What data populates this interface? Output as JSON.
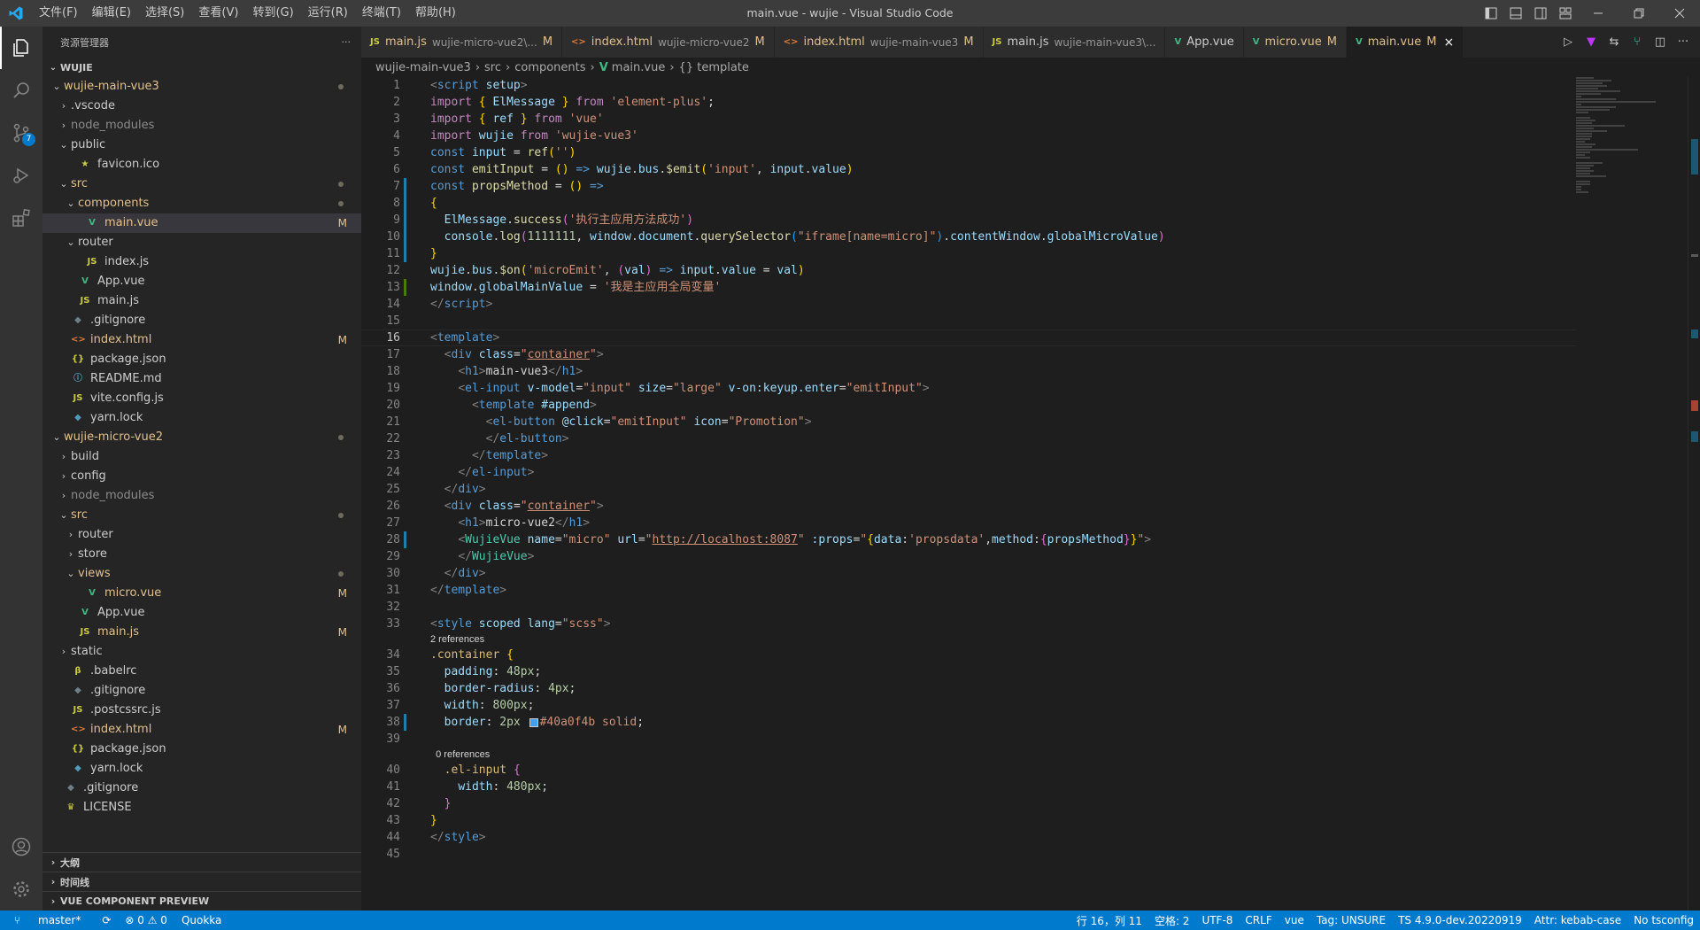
{
  "titlebar": {
    "menu": [
      "文件(F)",
      "编辑(E)",
      "选择(S)",
      "查看(V)",
      "转到(G)",
      "运行(R)",
      "终端(T)",
      "帮助(H)"
    ],
    "title": "main.vue - wujie - Visual Studio Code"
  },
  "activity": {
    "scm_badge": "7"
  },
  "sidebar": {
    "title": "资源管理器",
    "more": "···",
    "workspace": "WUJIE",
    "tree": [
      {
        "label": "wujie-main-vue3",
        "depth": 0,
        "type": "folder-open",
        "cls": "c-mod",
        "dot": true
      },
      {
        "label": ".vscode",
        "depth": 1,
        "type": "folder",
        "cls": "c-norm"
      },
      {
        "label": "node_modules",
        "depth": 1,
        "type": "folder",
        "cls": "c-dim"
      },
      {
        "label": "public",
        "depth": 1,
        "type": "folder-open",
        "cls": "c-norm"
      },
      {
        "label": "favicon.ico",
        "depth": 2,
        "type": "star",
        "cls": "c-norm"
      },
      {
        "label": "src",
        "depth": 1,
        "type": "folder-open",
        "cls": "c-mod",
        "dot": true
      },
      {
        "label": "components",
        "depth": 2,
        "type": "folder-open",
        "cls": "c-mod",
        "dot": true
      },
      {
        "label": "main.vue",
        "depth": 3,
        "type": "vue",
        "cls": "c-mod",
        "status": "M",
        "selected": true
      },
      {
        "label": "router",
        "depth": 2,
        "type": "folder-open",
        "cls": "c-norm"
      },
      {
        "label": "index.js",
        "depth": 3,
        "type": "js",
        "cls": "c-norm"
      },
      {
        "label": "App.vue",
        "depth": 2,
        "type": "vue",
        "cls": "c-norm"
      },
      {
        "label": "main.js",
        "depth": 2,
        "type": "js",
        "cls": "c-norm"
      },
      {
        "label": ".gitignore",
        "depth": 1,
        "type": "git",
        "cls": "c-norm"
      },
      {
        "label": "index.html",
        "depth": 1,
        "type": "html",
        "cls": "c-mod",
        "status": "M"
      },
      {
        "label": "package.json",
        "depth": 1,
        "type": "json",
        "cls": "c-norm"
      },
      {
        "label": "README.md",
        "depth": 1,
        "type": "info",
        "cls": "c-norm"
      },
      {
        "label": "vite.config.js",
        "depth": 1,
        "type": "js",
        "cls": "c-norm"
      },
      {
        "label": "yarn.lock",
        "depth": 1,
        "type": "yarn",
        "cls": "c-norm"
      },
      {
        "label": "wujie-micro-vue2",
        "depth": 0,
        "type": "folder-open",
        "cls": "c-mod",
        "dot": true
      },
      {
        "label": "build",
        "depth": 1,
        "type": "folder",
        "cls": "c-norm"
      },
      {
        "label": "config",
        "depth": 1,
        "type": "folder",
        "cls": "c-norm"
      },
      {
        "label": "node_modules",
        "depth": 1,
        "type": "folder",
        "cls": "c-dim"
      },
      {
        "label": "src",
        "depth": 1,
        "type": "folder-open",
        "cls": "c-mod",
        "dot": true
      },
      {
        "label": "router",
        "depth": 2,
        "type": "folder",
        "cls": "c-norm"
      },
      {
        "label": "store",
        "depth": 2,
        "type": "folder",
        "cls": "c-norm"
      },
      {
        "label": "views",
        "depth": 2,
        "type": "folder-open",
        "cls": "c-mod",
        "dot": true
      },
      {
        "label": "micro.vue",
        "depth": 3,
        "type": "vue",
        "cls": "c-mod",
        "status": "M"
      },
      {
        "label": "App.vue",
        "depth": 2,
        "type": "vue",
        "cls": "c-norm"
      },
      {
        "label": "main.js",
        "depth": 2,
        "type": "js",
        "cls": "c-mod",
        "status": "M"
      },
      {
        "label": "static",
        "depth": 1,
        "type": "folder",
        "cls": "c-norm"
      },
      {
        "label": ".babelrc",
        "depth": 1,
        "type": "babel",
        "cls": "c-norm"
      },
      {
        "label": ".gitignore",
        "depth": 1,
        "type": "git",
        "cls": "c-norm"
      },
      {
        "label": ".postcssrc.js",
        "depth": 1,
        "type": "js",
        "cls": "c-norm"
      },
      {
        "label": "index.html",
        "depth": 1,
        "type": "html",
        "cls": "c-mod",
        "status": "M"
      },
      {
        "label": "package.json",
        "depth": 1,
        "type": "json",
        "cls": "c-norm"
      },
      {
        "label": "yarn.lock",
        "depth": 1,
        "type": "yarn",
        "cls": "c-norm"
      },
      {
        "label": ".gitignore",
        "depth": 0,
        "type": "git",
        "cls": "c-norm"
      },
      {
        "label": "LICENSE",
        "depth": 0,
        "type": "license",
        "cls": "c-norm"
      }
    ],
    "sections": [
      "大纲",
      "时间线",
      "VUE COMPONENT PREVIEW"
    ]
  },
  "tabs": [
    {
      "icon": "JS",
      "name": "main.js",
      "desc": "wujie-micro-vue2\\...",
      "mark": "M",
      "active": false
    },
    {
      "icon": "<>",
      "name": "index.html",
      "desc": "wujie-micro-vue2",
      "mark": "M",
      "active": false
    },
    {
      "icon": "<>",
      "name": "index.html",
      "desc": "wujie-main-vue3",
      "mark": "M",
      "active": false
    },
    {
      "icon": "JS",
      "name": "main.js",
      "desc": "wujie-main-vue3\\...",
      "mark": "",
      "active": false
    },
    {
      "icon": "V",
      "name": "App.vue",
      "desc": "",
      "mark": "",
      "active": false
    },
    {
      "icon": "V",
      "name": "micro.vue",
      "desc": "",
      "mark": "M",
      "active": false
    },
    {
      "icon": "V",
      "name": "main.vue",
      "desc": "",
      "mark": "M",
      "active": true
    }
  ],
  "breadcrumb": [
    "wujie-main-vue3",
    "src",
    "components",
    "main.vue",
    "{} template"
  ],
  "code": {
    "lens_2_refs": "2 references",
    "lens_0_refs": "0 references",
    "l9_msg": "'执行主应用方法成功'",
    "l10_num": "1111111",
    "l10_sel": "\"iframe[name=micro]\"",
    "l13_str": "'我是主应用全局变量'",
    "url": "http://localhost:8087",
    "color_hex": "#40a0f4b",
    "main_h1": "main-vue3",
    "micro_h1": "micro-vue2"
  },
  "colors": {
    "accent": "#007acc",
    "swatch": "#40a0f4"
  },
  "statusbar": {
    "branch": "master*",
    "sync": "⟳",
    "problems": "⊗ 0 ⚠ 0",
    "quokka": "Quokka",
    "position": "行 16，列 11",
    "spaces": "空格: 2",
    "encoding": "UTF-8",
    "eol": "CRLF",
    "language": "vue",
    "tag": "Tag: UNSURE",
    "ts": "TS 4.9.0-dev.20220919",
    "attr": "Attr: kebab-case",
    "tsconfig": "No tsconfig"
  }
}
